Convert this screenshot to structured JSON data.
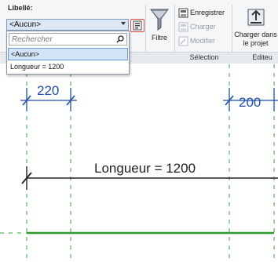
{
  "ribbon": {
    "properties": {
      "label": "Libellé:",
      "selected_type": "<Aucun>"
    },
    "filter": {
      "label": "Filtre"
    },
    "selection": {
      "save_label": "Enregistrer",
      "load_label": "Charger",
      "modify_label": "Modifier",
      "group_label": "Sélection"
    },
    "editor": {
      "load_in_project_label": "Charger dans le projet",
      "load_in_project_line1": "Charger dans",
      "load_in_project_line2": "le projet",
      "group_label": "Editeu"
    }
  },
  "dropdown": {
    "search_placeholder": "Rechercher",
    "items": [
      "<Aucun>",
      "Longueur = 1200"
    ]
  },
  "canvas": {
    "dimension_left": "220",
    "dimension_right": "200",
    "label": "Longueur = 1200",
    "colors": {
      "dimension": "#1f4fa8",
      "label_line": "#222222",
      "reference_line": "#2e9a2e",
      "ref_plane": "#3aa03a"
    }
  },
  "colors": {
    "highlight_border": "#e04545",
    "combo_bg": "#dce6f4",
    "selected_item_bg": "#d2e3f5"
  }
}
